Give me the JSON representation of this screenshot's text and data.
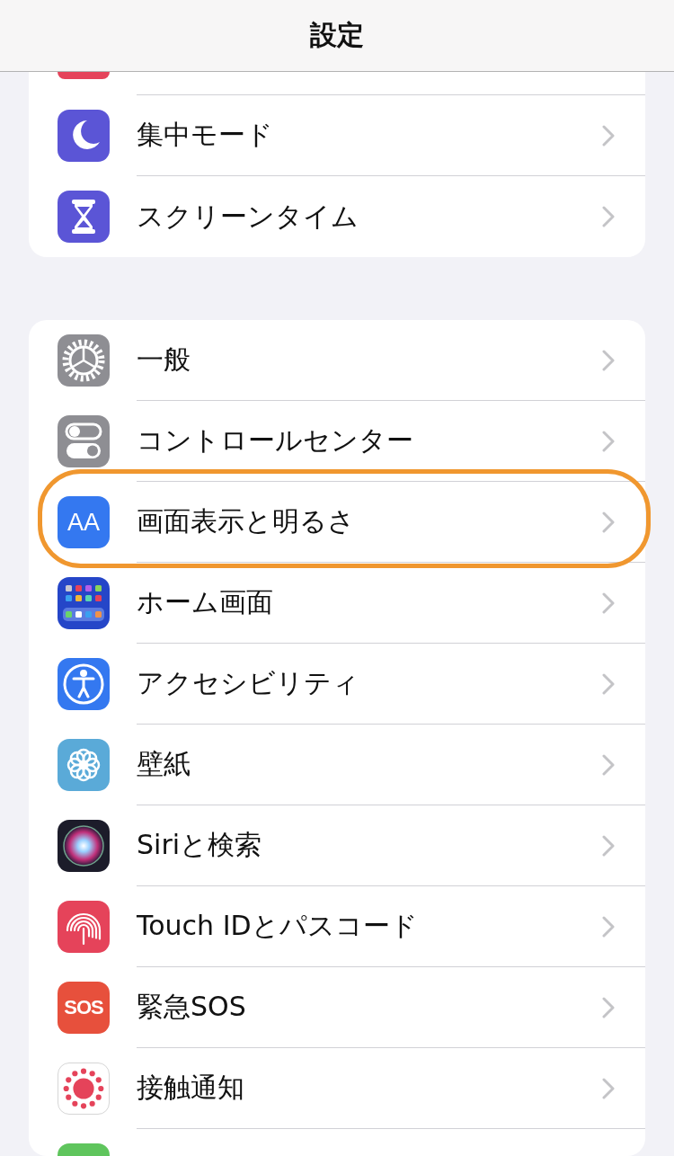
{
  "header": {
    "title": "設定"
  },
  "groups": [
    {
      "rows": [
        {
          "kind": "cutoff",
          "color": "#e5435a"
        },
        {
          "kind": "focus",
          "label": "集中モード",
          "color": "#5b55d6",
          "highlighted": false
        },
        {
          "kind": "screentime",
          "label": "スクリーンタイム",
          "color": "#5b55d6",
          "highlighted": false
        }
      ]
    },
    {
      "rows": [
        {
          "kind": "general",
          "label": "一般",
          "color": "#8e8e93",
          "highlighted": false
        },
        {
          "kind": "control",
          "label": "コントロールセンター",
          "color": "#8e8e93",
          "highlighted": false
        },
        {
          "kind": "display",
          "label": "画面表示と明るさ",
          "glyph": "AA",
          "color": "#3478f0",
          "highlighted": true
        },
        {
          "kind": "home",
          "label": "ホーム画面",
          "color": "#2546c8",
          "highlighted": false
        },
        {
          "kind": "accessibility",
          "label": "アクセシビリティ",
          "color": "#3478f0",
          "highlighted": false
        },
        {
          "kind": "wallpaper",
          "label": "壁紙",
          "color": "#5aaad8",
          "highlighted": false
        },
        {
          "kind": "siri",
          "label": "Siriと検索",
          "color": "#1c1c2a",
          "highlighted": false
        },
        {
          "kind": "touchid",
          "label": "Touch IDとパスコード",
          "color": "#e5435a",
          "highlighted": false
        },
        {
          "kind": "sos",
          "label": "緊急SOS",
          "glyph": "SOS",
          "color": "#e7503c",
          "highlighted": false
        },
        {
          "kind": "exposure",
          "label": "接触通知",
          "color": "#ffffff",
          "highlighted": false
        },
        {
          "kind": "cutoff",
          "color": "#5fc55d"
        }
      ]
    }
  ]
}
